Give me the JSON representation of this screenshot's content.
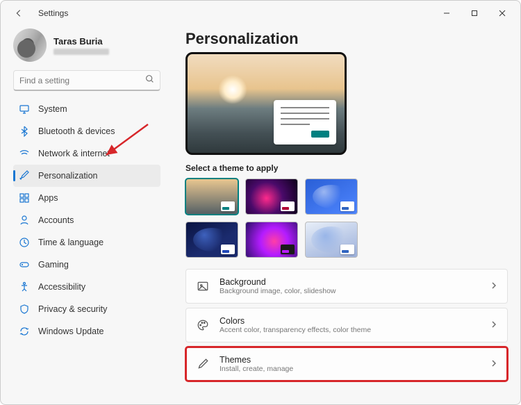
{
  "window": {
    "title": "Settings"
  },
  "user": {
    "name": "Taras Buria"
  },
  "search": {
    "placeholder": "Find a setting"
  },
  "sidebar": {
    "items": [
      {
        "label": "System"
      },
      {
        "label": "Bluetooth & devices"
      },
      {
        "label": "Network & internet"
      },
      {
        "label": "Personalization"
      },
      {
        "label": "Apps"
      },
      {
        "label": "Accounts"
      },
      {
        "label": "Time & language"
      },
      {
        "label": "Gaming"
      },
      {
        "label": "Accessibility"
      },
      {
        "label": "Privacy & security"
      },
      {
        "label": "Windows Update"
      }
    ]
  },
  "main": {
    "title": "Personalization",
    "section_label": "Select a theme to apply",
    "cards": {
      "background": {
        "title": "Background",
        "subtitle": "Background image, color, slideshow"
      },
      "colors": {
        "title": "Colors",
        "subtitle": "Accent color, transparency effects, color theme"
      },
      "themes": {
        "title": "Themes",
        "subtitle": "Install, create, manage"
      }
    }
  }
}
